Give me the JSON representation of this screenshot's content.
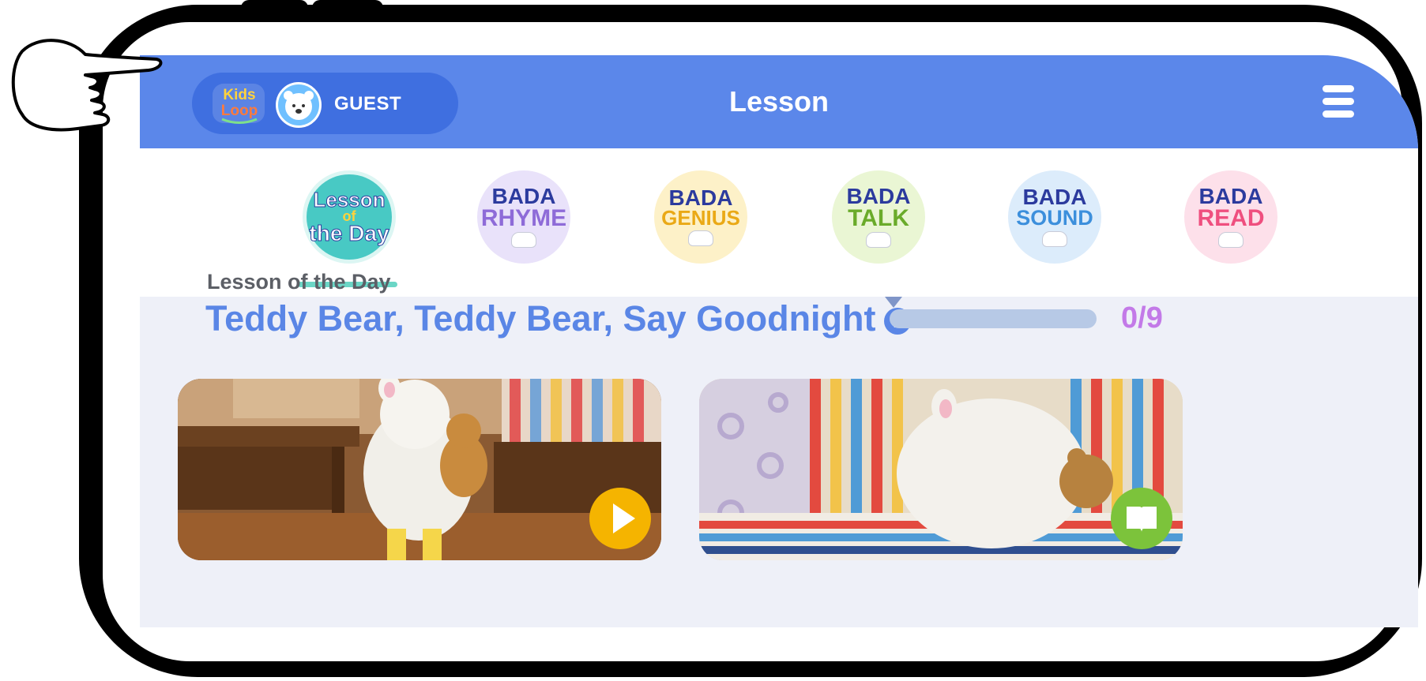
{
  "header": {
    "title": "Lesson",
    "user_label": "GUEST",
    "logo_text_line1": "Kids",
    "logo_text_line2": "Loop"
  },
  "categories": [
    {
      "id": "lesson-of-the-day",
      "line1": "Lesson",
      "line2": "of",
      "line3": "the Day",
      "color": "#29c4c6",
      "selected": true
    },
    {
      "id": "bada-rhyme",
      "line1": "BADA",
      "line2": "RHYME",
      "color": "#a58ae0",
      "selected": false
    },
    {
      "id": "bada-genius",
      "line1": "BADA",
      "line2": "GENIUS",
      "color": "#f3c43d",
      "selected": false
    },
    {
      "id": "bada-talk",
      "line1": "BADA",
      "line2": "TALK",
      "color": "#a9d860",
      "selected": false
    },
    {
      "id": "bada-sound",
      "line1": "BADA",
      "line2": "SOUND",
      "color": "#5da9e8",
      "selected": false
    },
    {
      "id": "bada-read",
      "line1": "BADA",
      "line2": "READ",
      "color": "#f27aa5",
      "selected": false
    }
  ],
  "lesson": {
    "label": "Lesson of the Day",
    "title": "Teddy Bear, Teddy Bear, Say Goodnight",
    "progress_text": "0/9",
    "progress_fraction": 0
  },
  "cards": [
    {
      "type": "video",
      "icon": "play-icon"
    },
    {
      "type": "book",
      "icon": "book-icon"
    }
  ],
  "colors": {
    "header_bg": "#5b87ea",
    "accent_blue": "#5a86e6",
    "progress_purple": "#c37ae8",
    "selected_underline": "#6bd6c6"
  }
}
